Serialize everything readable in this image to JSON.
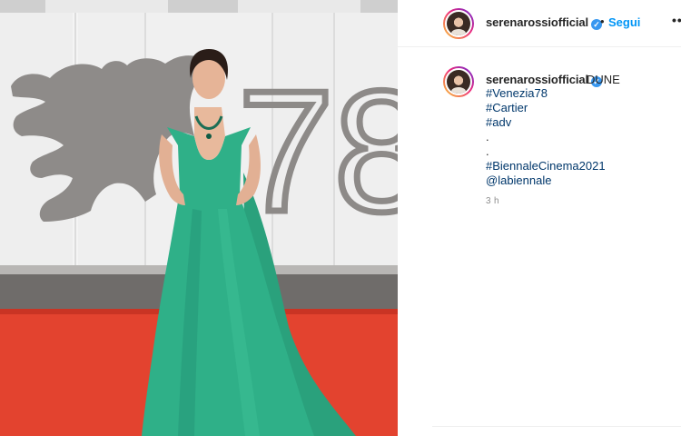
{
  "post": {
    "username": "serenarossiofficial",
    "verified_icon": "verified-badge-icon",
    "separator": "•",
    "follow_label": "Segui",
    "more_label": "••",
    "caption_title": "DUNE",
    "caption_lines": [
      {
        "text": "#Venezia78",
        "kind": "hashtag"
      },
      {
        "text": "#Cartier",
        "kind": "hashtag"
      },
      {
        "text": "#adv",
        "kind": "hashtag"
      },
      {
        "text": ".",
        "kind": "plain"
      },
      {
        "text": ".",
        "kind": "plain"
      },
      {
        "text": "#BiennaleCinema2021",
        "kind": "hashtag"
      },
      {
        "text": "@labiennale",
        "kind": "mention"
      }
    ],
    "timestamp": "3 h"
  },
  "photo": {
    "backdrop_text": "78",
    "colors": {
      "backdrop": "#f2f2f2",
      "lion": "#8d8a88",
      "carpet": "#e2442f",
      "dress": "#2fae86",
      "step": "#6d6b69"
    }
  },
  "colors": {
    "accent_link": "#0095f6",
    "hashtag": "#00376b",
    "text": "#262626",
    "muted": "#8e8e8e"
  }
}
